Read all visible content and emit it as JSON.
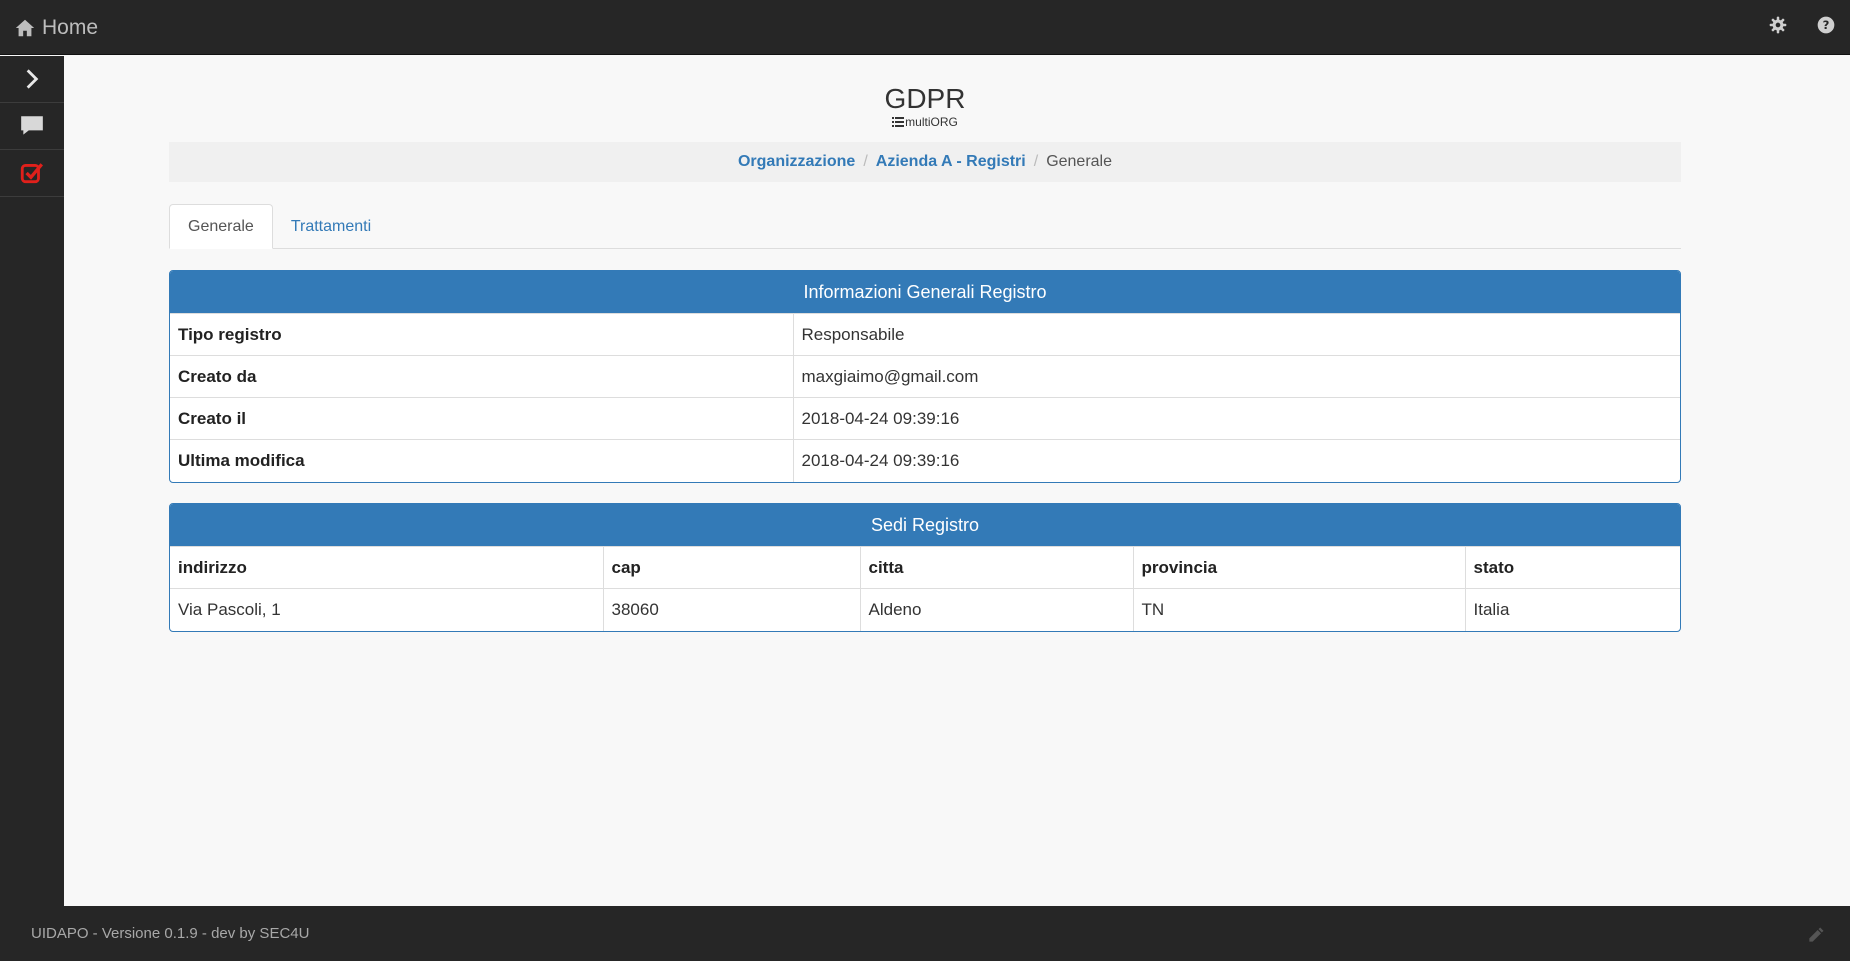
{
  "topbar": {
    "home_label": "Home"
  },
  "page": {
    "title": "GDPR",
    "subtitle": "multiORG"
  },
  "breadcrumb": {
    "item1": "Organizzazione",
    "item2": "Azienda A - Registri",
    "current": "Generale"
  },
  "tabs": {
    "generale": "Generale",
    "trattamenti": "Trattamenti"
  },
  "info_panel": {
    "heading": "Informazioni Generali Registro",
    "rows": [
      {
        "label": "Tipo registro",
        "value": "Responsabile"
      },
      {
        "label": "Creato da",
        "value": "maxgiaimo@gmail.com"
      },
      {
        "label": "Creato il",
        "value": "2018-04-24 09:39:16"
      },
      {
        "label": "Ultima modifica",
        "value": "2018-04-24 09:39:16"
      }
    ]
  },
  "sedi_panel": {
    "heading": "Sedi Registro",
    "columns": [
      "indirizzo",
      "cap",
      "citta",
      "provincia",
      "stato"
    ],
    "rows": [
      [
        "Via Pascoli, 1",
        "38060",
        "Aldeno",
        "TN",
        "Italia"
      ]
    ]
  },
  "footer": {
    "text": "UIDAPO - Versione 0.1.9 - dev by SEC4U"
  },
  "colors": {
    "primary": "#337ab7",
    "dark": "#262626",
    "task_icon": "#e0201b"
  },
  "icons": [
    "home-icon",
    "gear-icon",
    "help-icon",
    "chevron-right-icon",
    "chat-icon",
    "task-check-icon",
    "list-icon",
    "pencil-icon"
  ]
}
